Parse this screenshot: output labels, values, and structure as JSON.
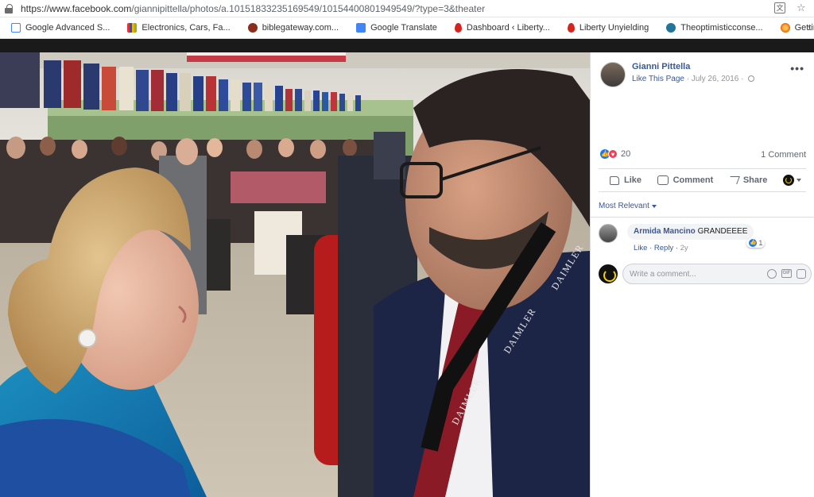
{
  "browser": {
    "url_main": "https://www.facebook.com",
    "url_rest": "/giannipittella/photos/a.10151833235169549/10154400801949549/?type=3&theater"
  },
  "bookmarks": [
    {
      "label": "Google Advanced S...",
      "color": "#4285f4"
    },
    {
      "label": "Electronics, Cars, Fa...",
      "color": "#e53238"
    },
    {
      "label": "biblegateway.com...",
      "color": "#8b2d1a"
    },
    {
      "label": "Google Translate",
      "color": "#4285f4"
    },
    {
      "label": "Dashboard ‹ Liberty...",
      "color": "#d4241c"
    },
    {
      "label": "Liberty Unyielding",
      "color": "#d4241c"
    },
    {
      "label": "Theoptimisticconse...",
      "color": "#21759b"
    },
    {
      "label": "Getting Started",
      "color": "#e66000"
    }
  ],
  "post": {
    "author": "Gianni Pittella",
    "like_page": "Like This Page",
    "date": "July 26, 2016",
    "separator": "·",
    "reaction_count": "20",
    "comment_count": "1 Comment",
    "actions": {
      "like": "Like",
      "comment": "Comment",
      "share": "Share"
    },
    "sort_label": "Most Relevant",
    "comment": {
      "name": "Armida Mancino",
      "text": "GRANDEEEE",
      "like": "Like",
      "reply": "Reply",
      "time": "2y",
      "react_count": "1"
    },
    "write_placeholder": "Write a comment..."
  },
  "photo": {
    "lanyard_text": "DAIMLER"
  }
}
